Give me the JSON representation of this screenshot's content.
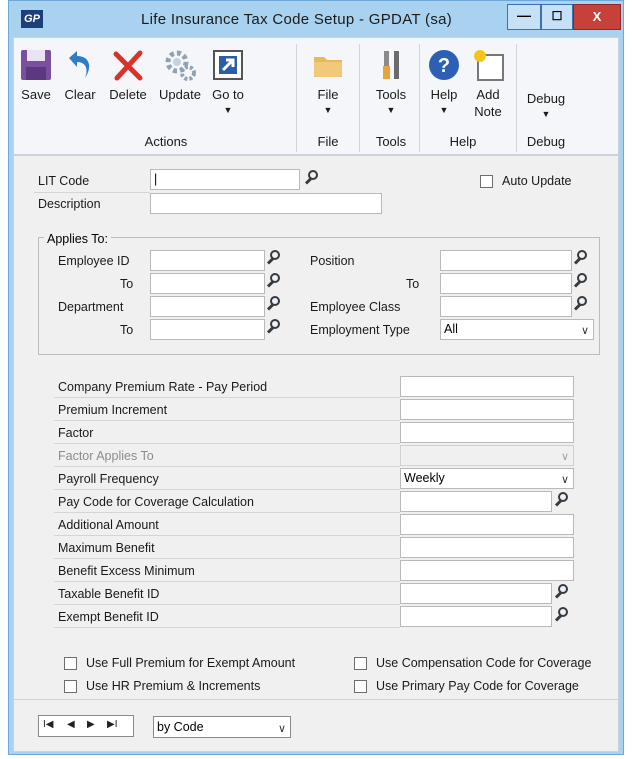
{
  "window": {
    "title": "Life Insurance Tax Code Setup  -  GPDAT (sa)",
    "app_icon": "GP"
  },
  "controls": {
    "minimize": "—",
    "maximize": "☐",
    "close": "X"
  },
  "ribbon": {
    "buttons": {
      "save": "Save",
      "clear": "Clear",
      "delete": "Delete",
      "update": "Update",
      "goto": "Go to",
      "file": "File",
      "tools": "Tools",
      "help": "Help",
      "add_note_1": "Add",
      "add_note_2": "Note",
      "debug": "Debug"
    },
    "groups": {
      "actions": "Actions",
      "file": "File",
      "tools": "Tools",
      "help": "Help",
      "debug": "Debug"
    },
    "arrow": "▼"
  },
  "form": {
    "lit_code_label": "LIT Code",
    "lit_code_value": "|",
    "description_label": "Description",
    "auto_update_label": "Auto Update",
    "applies_to_title": "Applies To:",
    "employee_id_label": "Employee ID",
    "to_label": "To",
    "department_label": "Department",
    "position_label": "Position",
    "employee_class_label": "Employee Class",
    "employment_type_label": "Employment Type",
    "employment_type_value": "All",
    "details": [
      {
        "label": "Company Premium Rate - Pay Period"
      },
      {
        "label": "Premium Increment"
      },
      {
        "label": "Factor"
      },
      {
        "label": "Factor Applies To"
      },
      {
        "label": "Payroll Frequency",
        "value": "Weekly"
      },
      {
        "label": "Pay Code for Coverage Calculation"
      },
      {
        "label": "Additional Amount"
      },
      {
        "label": "Maximum Benefit"
      },
      {
        "label": "Benefit Excess Minimum"
      },
      {
        "label": "Taxable Benefit ID"
      },
      {
        "label": "Exempt Benefit ID"
      }
    ],
    "options": {
      "full_premium": "Use Full Premium for Exempt Amount",
      "hr_premium": "Use HR Premium & Increments",
      "comp_code": "Use Compensation Code for Coverage",
      "primary_pay": "Use Primary Pay Code for Coverage"
    }
  },
  "footer": {
    "nav": {
      "first": "I◀",
      "prev": "◀",
      "next": "▶",
      "last": "▶I"
    },
    "sort_value": "by Code"
  },
  "colors": {
    "title_bg": "#a9d2f0",
    "close_bg": "#c7413a",
    "panel_bg": "#f0f0f0"
  }
}
